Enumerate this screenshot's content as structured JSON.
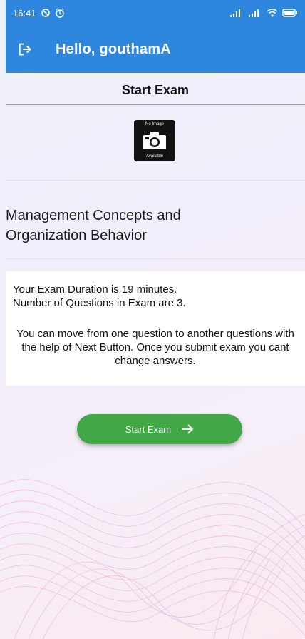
{
  "status_bar": {
    "time": "16:41",
    "battery_icon": "battery-icon",
    "wifi_icon": "wifi-icon"
  },
  "app_bar": {
    "greeting": "Hello, gouthamA",
    "logout_icon": "logout-icon"
  },
  "page": {
    "section_title": "Start Exam"
  },
  "exam_image": {
    "top_text": "No Image",
    "bottom_text": "Available",
    "icon": "camera-icon"
  },
  "course": {
    "name_line1": "Management Concepts and",
    "name_line2": "Organization Behavior"
  },
  "info": {
    "duration": "Your Exam Duration is 19 minutes.",
    "questions": "Number of Questions in Exam are 3.",
    "instructions": "You can move from one question to another questions with the help of Next Button. Once you submit exam you cant change answers."
  },
  "start_button": {
    "label": "Start Exam",
    "icon": "arrow-right-icon"
  },
  "colors": {
    "app_bar": "#2f86de",
    "button": "#42a847"
  }
}
